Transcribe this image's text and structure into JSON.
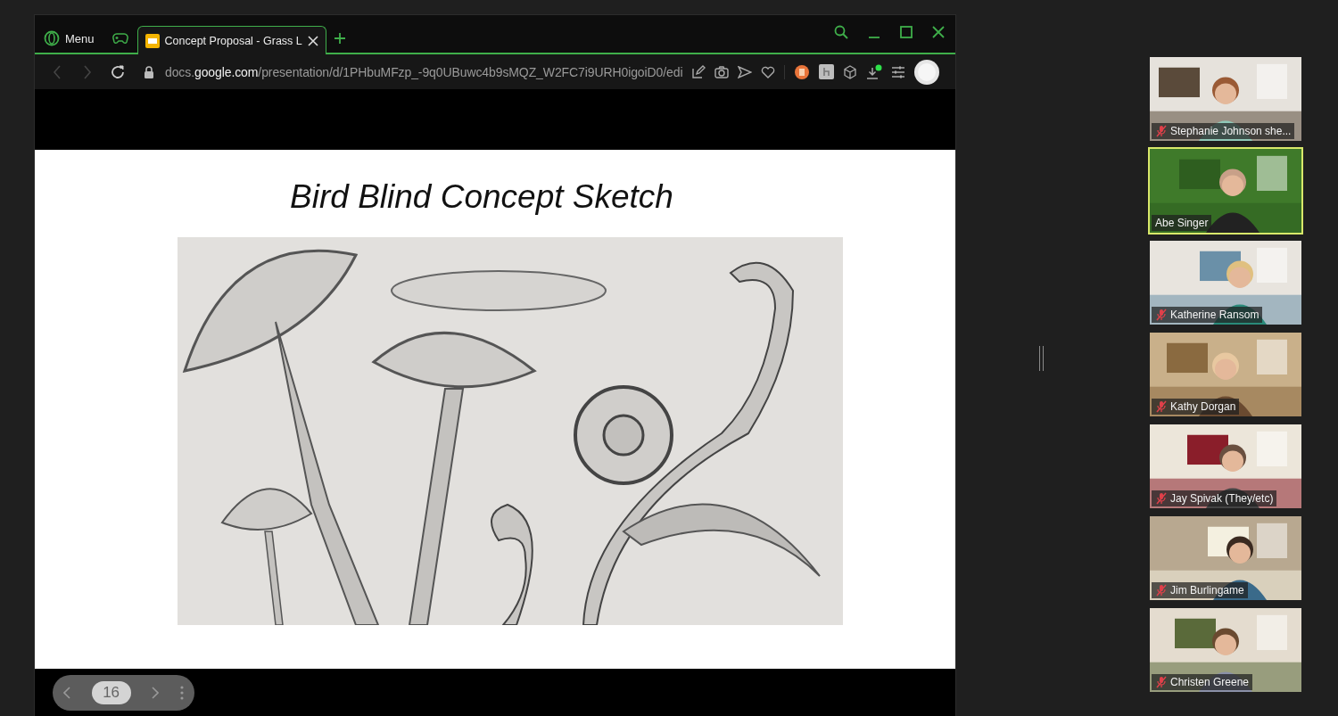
{
  "browser": {
    "menu": {
      "label": "Menu"
    },
    "tabs": [
      {
        "title": "Concept Proposal - Grass L",
        "selected": true
      }
    ],
    "url": "docs.**google.com**/presentation/d/1PHbuMFzp_-9q0UBuwc4b9sMQZ_W2FC7i9URH0igoiD0/edi"
  },
  "slide": {
    "title": "Bird Blind Concept Sketch"
  },
  "slide_nav": {
    "page": "16"
  },
  "participants": [
    {
      "name": "Stephanie Johnson she...",
      "muted": true,
      "speaking": false
    },
    {
      "name": "Abe Singer",
      "muted": false,
      "speaking": true
    },
    {
      "name": "Katherine Ransom",
      "muted": true,
      "speaking": false
    },
    {
      "name": "Kathy Dorgan",
      "muted": true,
      "speaking": false
    },
    {
      "name": "Jay Spivak (They/etc)",
      "muted": true,
      "speaking": false
    },
    {
      "name": "Jim Burlingame",
      "muted": true,
      "speaking": false
    },
    {
      "name": "Christen Greene",
      "muted": true,
      "speaking": false
    }
  ]
}
